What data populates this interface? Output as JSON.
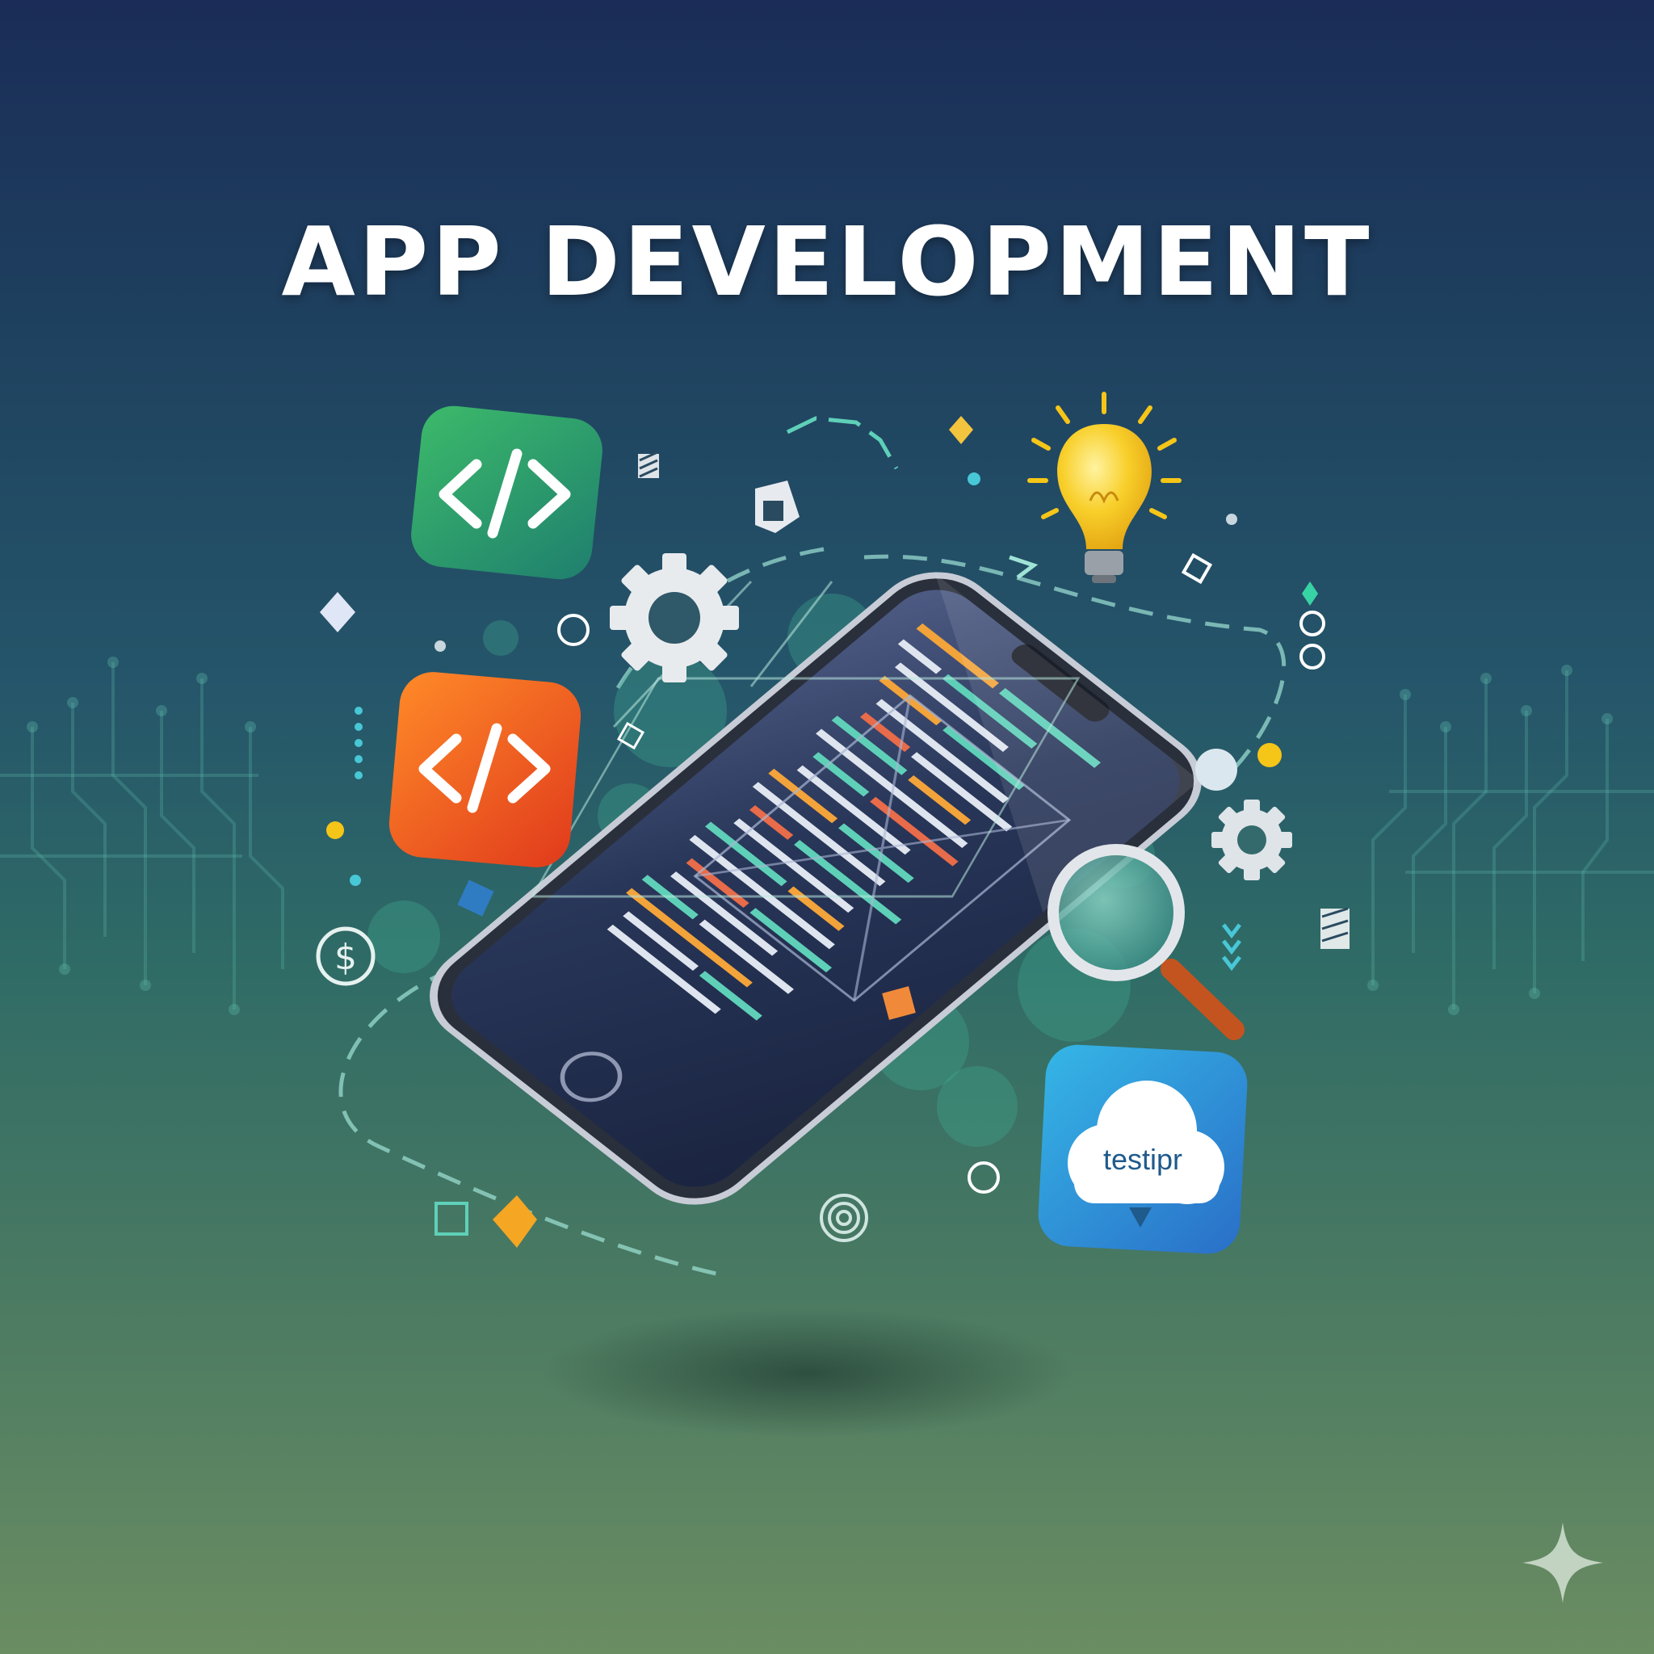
{
  "title": "APP DEVELOPMENT",
  "cloud_badge": {
    "text": "testipr"
  },
  "icons": {
    "code_badge_green": "code-icon",
    "code_badge_orange": "code-icon",
    "cloud_badge": "cloud-icon",
    "lightbulb": "lightbulb-icon",
    "gears": "gear-icon",
    "magnifier": "magnifier-icon",
    "dollar": "dollar-icon",
    "sparkle": "sparkle-icon"
  },
  "colors": {
    "background_top": "#1a2c57",
    "background_bottom": "#6b8d62",
    "accent_teal": "#5fd0b8",
    "code_green_badge": "#2e9e5e",
    "code_orange_badge": "#f0571f",
    "cloud_blue_badge": "#2f8fd8",
    "bulb_yellow": "#f5c518"
  }
}
